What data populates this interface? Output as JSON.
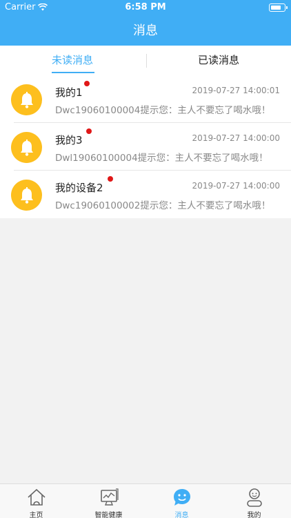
{
  "status_bar": {
    "carrier": "Carrier",
    "time": "6:58 PM"
  },
  "header": {
    "title": "消息"
  },
  "tabs": [
    {
      "label": "未读消息",
      "active": true
    },
    {
      "label": "已读消息",
      "active": false
    }
  ],
  "messages": [
    {
      "name": "我的1",
      "unread": true,
      "date": "2019-07-27 14:00:01",
      "text": "Dwc19060100004提示您：主人不要忘了喝水哦！",
      "icon": "bell-icon"
    },
    {
      "name": "我的3",
      "unread": true,
      "date": "2019-07-27 14:00:00",
      "text": "Dwl19060100004提示您：主人不要忘了喝水哦！",
      "icon": "bell-icon"
    },
    {
      "name": "我的设备2",
      "unread": true,
      "date": "2019-07-27 14:00:00",
      "text": "Dwc19060100002提示您：主人不要忘了喝水哦！",
      "icon": "bell-icon"
    }
  ],
  "tabbar": [
    {
      "label": "主页",
      "icon": "home-icon",
      "active": false
    },
    {
      "label": "智能健康",
      "icon": "monitor-chart-icon",
      "active": false
    },
    {
      "label": "消息",
      "icon": "chat-bubble-icon",
      "active": true
    },
    {
      "label": "我的",
      "icon": "user-icon",
      "active": false
    }
  ],
  "colors": {
    "primary": "#40aef5",
    "bell": "#fdbf1e",
    "unread_dot": "#e01818"
  }
}
